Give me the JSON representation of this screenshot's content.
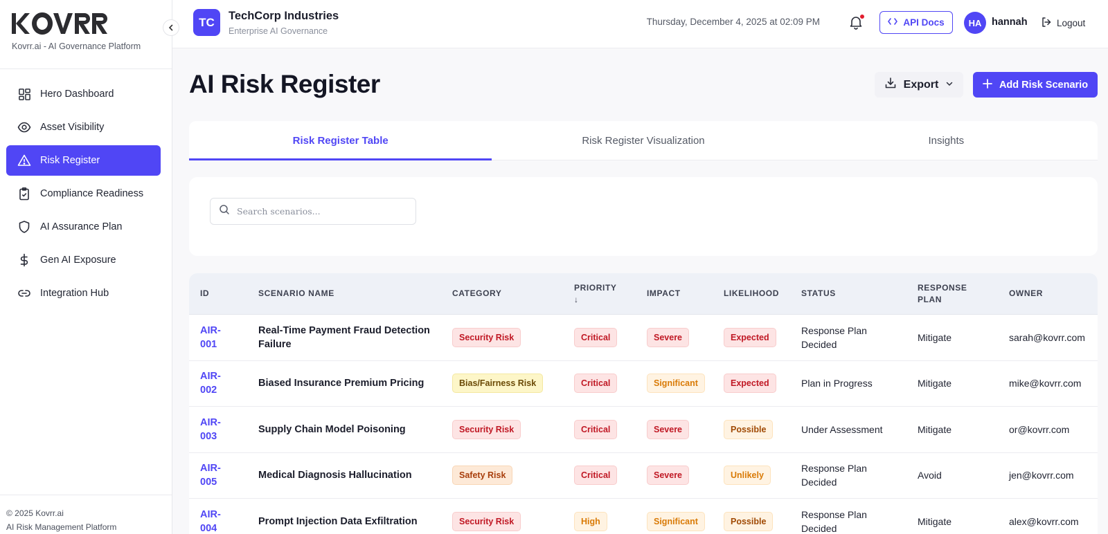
{
  "sidebar": {
    "brand_logo": "KOVRR",
    "brand_subtitle": "Kovrr.ai - AI Governance Platform",
    "items": [
      {
        "label": "Hero Dashboard",
        "icon": "dashboard-icon"
      },
      {
        "label": "Asset Visibility",
        "icon": "eye-icon"
      },
      {
        "label": "Risk Register",
        "icon": "warning-icon",
        "active": true
      },
      {
        "label": "Compliance Readiness",
        "icon": "clipboard-icon"
      },
      {
        "label": "AI Assurance Plan",
        "icon": "shield-icon"
      },
      {
        "label": "Gen AI Exposure",
        "icon": "dollar-icon"
      },
      {
        "label": "Integration Hub",
        "icon": "link-icon"
      }
    ],
    "footer_line1": "© 2025 Kovrr.ai",
    "footer_line2": "AI Risk Management Platform"
  },
  "topbar": {
    "org_initials": "TC",
    "org_name": "TechCorp Industries",
    "org_subtitle": "Enterprise AI Governance",
    "datetime": "Thursday, December 4, 2025 at 02:09 PM",
    "api_docs_label": "API Docs",
    "user_initials": "HA",
    "user_name": "hannah",
    "logout_label": "Logout"
  },
  "page": {
    "title": "AI Risk Register",
    "export_label": "Export",
    "add_label": "Add Risk Scenario"
  },
  "tabs": [
    {
      "label": "Risk Register Table",
      "active": true
    },
    {
      "label": "Risk Register Visualization"
    },
    {
      "label": "Insights"
    }
  ],
  "search": {
    "placeholder": "Search scenarios..."
  },
  "table": {
    "headers": [
      "ID",
      "SCENARIO NAME",
      "CATEGORY",
      "PRIORITY ↓",
      "IMPACT",
      "LIKELIHOOD",
      "STATUS",
      "RESPONSE PLAN",
      "OWNER"
    ],
    "rows": [
      {
        "id": "AIR-001",
        "name": "Real-Time Payment Fraud Detection Failure",
        "category": "Security Risk",
        "priority": "Critical",
        "impact": "Severe",
        "likelihood": "Expected",
        "status": "Response Plan Decided",
        "response": "Mitigate",
        "owner": "sarah@kovrr.com"
      },
      {
        "id": "AIR-002",
        "name": "Biased Insurance Premium Pricing",
        "category": "Bias/Fairness Risk",
        "priority": "Critical",
        "impact": "Significant",
        "likelihood": "Expected",
        "status": "Plan in Progress",
        "response": "Mitigate",
        "owner": "mike@kovrr.com"
      },
      {
        "id": "AIR-003",
        "name": "Supply Chain Model Poisoning",
        "category": "Security Risk",
        "priority": "Critical",
        "impact": "Severe",
        "likelihood": "Possible",
        "status": "Under Assessment",
        "response": "Mitigate",
        "owner": "or@kovrr.com"
      },
      {
        "id": "AIR-005",
        "name": "Medical Diagnosis Hallucination",
        "category": "Safety Risk",
        "priority": "Critical",
        "impact": "Severe",
        "likelihood": "Unlikely",
        "status": "Response Plan Decided",
        "response": "Avoid",
        "owner": "jen@kovrr.com"
      },
      {
        "id": "AIR-004",
        "name": "Prompt Injection Data Exfiltration",
        "category": "Security Risk",
        "priority": "High",
        "impact": "Significant",
        "likelihood": "Possible",
        "status": "Response Plan Decided",
        "response": "Mitigate",
        "owner": "alex@kovrr.com"
      }
    ]
  },
  "colors": {
    "accent": "#5046f5",
    "danger": "#c01824",
    "warning": "#d97a06"
  }
}
